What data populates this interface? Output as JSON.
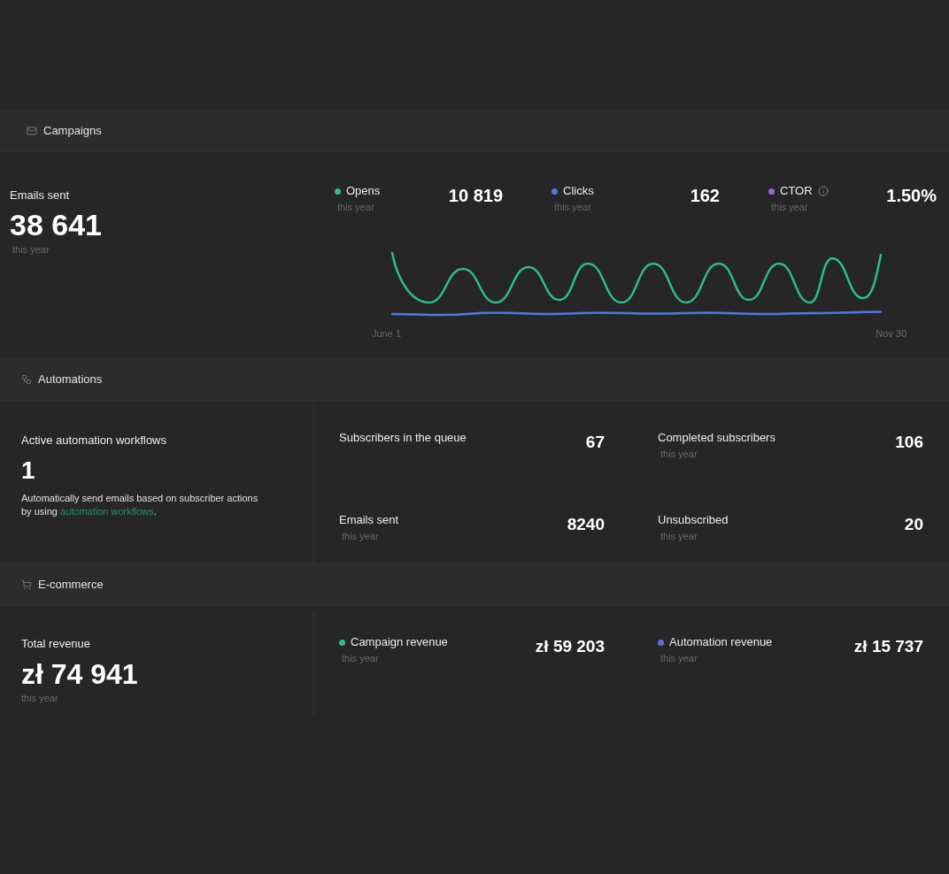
{
  "campaigns": {
    "title": "Campaigns",
    "summary": {
      "label": "Emails sent",
      "value": "38 641",
      "period": "this year"
    },
    "metrics": [
      {
        "label": "Opens",
        "period": "this year",
        "value": "10 819",
        "color": "#2ebd88",
        "info": false
      },
      {
        "label": "Clicks",
        "period": "this year",
        "value": "162",
        "color": "#4c7be0",
        "info": false
      },
      {
        "label": "CTOR",
        "period": "this year",
        "value": "1.50%",
        "color": "#9a63e0",
        "info": true
      }
    ],
    "chart": {
      "x_start": "June 1",
      "x_end": "Nov 30"
    }
  },
  "automations": {
    "title": "Automations",
    "summary": {
      "label": "Active automation workflows",
      "value": "1",
      "text": "Automatically send emails based on subscriber actions by using",
      "link": "automation workflows",
      "text_end": "."
    },
    "metrics": [
      {
        "label": "Subscribers in the queue",
        "value": "67"
      },
      {
        "label": "Completed subscribers",
        "period": "this year",
        "value": "106"
      },
      {
        "label": "Emails sent",
        "period": "this year",
        "value": "8240"
      },
      {
        "label": "Unsubscribed",
        "period": "this year",
        "value": "20"
      }
    ]
  },
  "ecommerce": {
    "title": "E-commerce",
    "summary": {
      "label": "Total revenue",
      "value": "zł 74 941",
      "period": "this year"
    },
    "metrics": [
      {
        "label": "Campaign revenue",
        "period": "this year",
        "value": "zł 59 203",
        "color": "#2ebd88"
      },
      {
        "label": "Automation revenue",
        "period": "this year",
        "value": "zł 15 737",
        "color": "#5a6ee6"
      }
    ]
  }
}
